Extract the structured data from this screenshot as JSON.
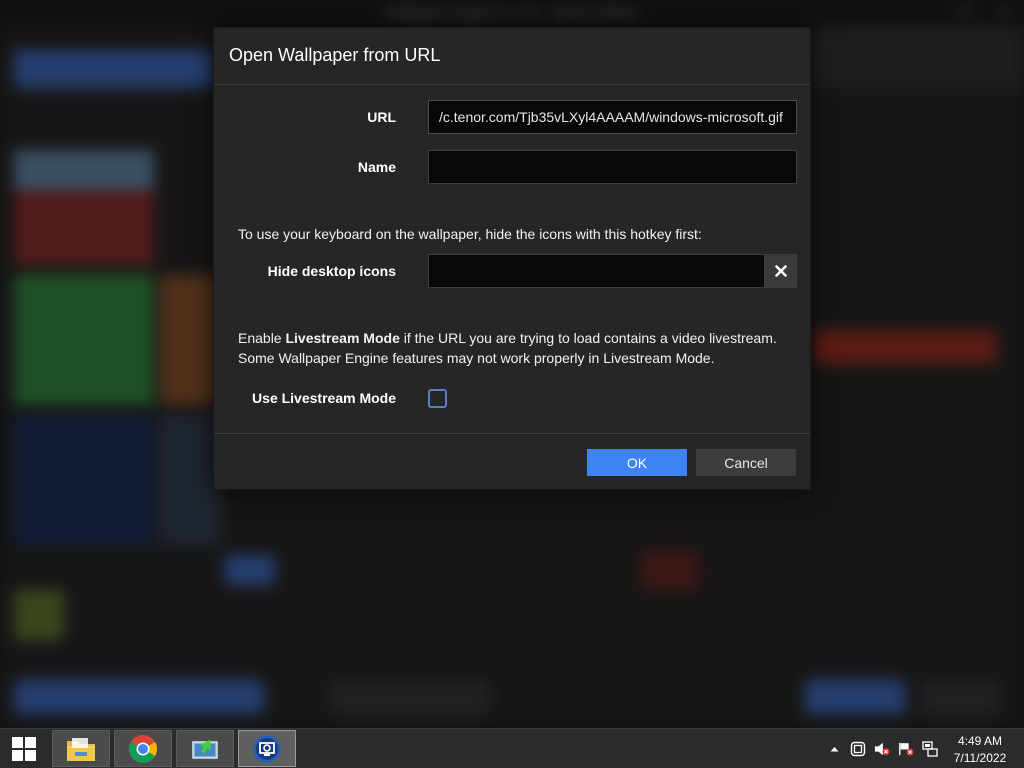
{
  "background_app": {
    "title": "Wallpaper Engine 2.1.32 - Steam Edition"
  },
  "dialog": {
    "title": "Open Wallpaper from URL",
    "url_label": "URL",
    "url_value": "/c.tenor.com/Tjb35vLXyl4AAAAM/windows-microsoft.gif",
    "name_label": "Name",
    "name_value": "",
    "hotkey_info": "To use your keyboard on the wallpaper, hide the icons with this hotkey first:",
    "hide_icons_label": "Hide desktop icons",
    "hide_icons_value": "",
    "livestream_info_prefix": "Enable ",
    "livestream_info_bold": "Livestream Mode",
    "livestream_info_suffix": " if the URL you are trying to load contains a video livestream.",
    "livestream_info_line2": "Some Wallpaper Engine features may not work properly in Livestream Mode.",
    "livestream_label": "Use Livestream Mode",
    "livestream_checked": false,
    "ok_label": "OK",
    "cancel_label": "Cancel"
  },
  "taskbar": {
    "apps": [
      {
        "name": "file-explorer",
        "icon": "folder-icon"
      },
      {
        "name": "chrome",
        "icon": "chrome-icon"
      },
      {
        "name": "installer",
        "icon": "installer-icon"
      },
      {
        "name": "wallpaper-engine",
        "icon": "wallpaper-engine-icon",
        "active": true
      }
    ],
    "time": "4:49 AM",
    "date": "7/11/2022"
  },
  "colors": {
    "accent": "#3d84f2",
    "dialog_bg": "#262626",
    "checkbox_border": "#5a7fc7"
  }
}
